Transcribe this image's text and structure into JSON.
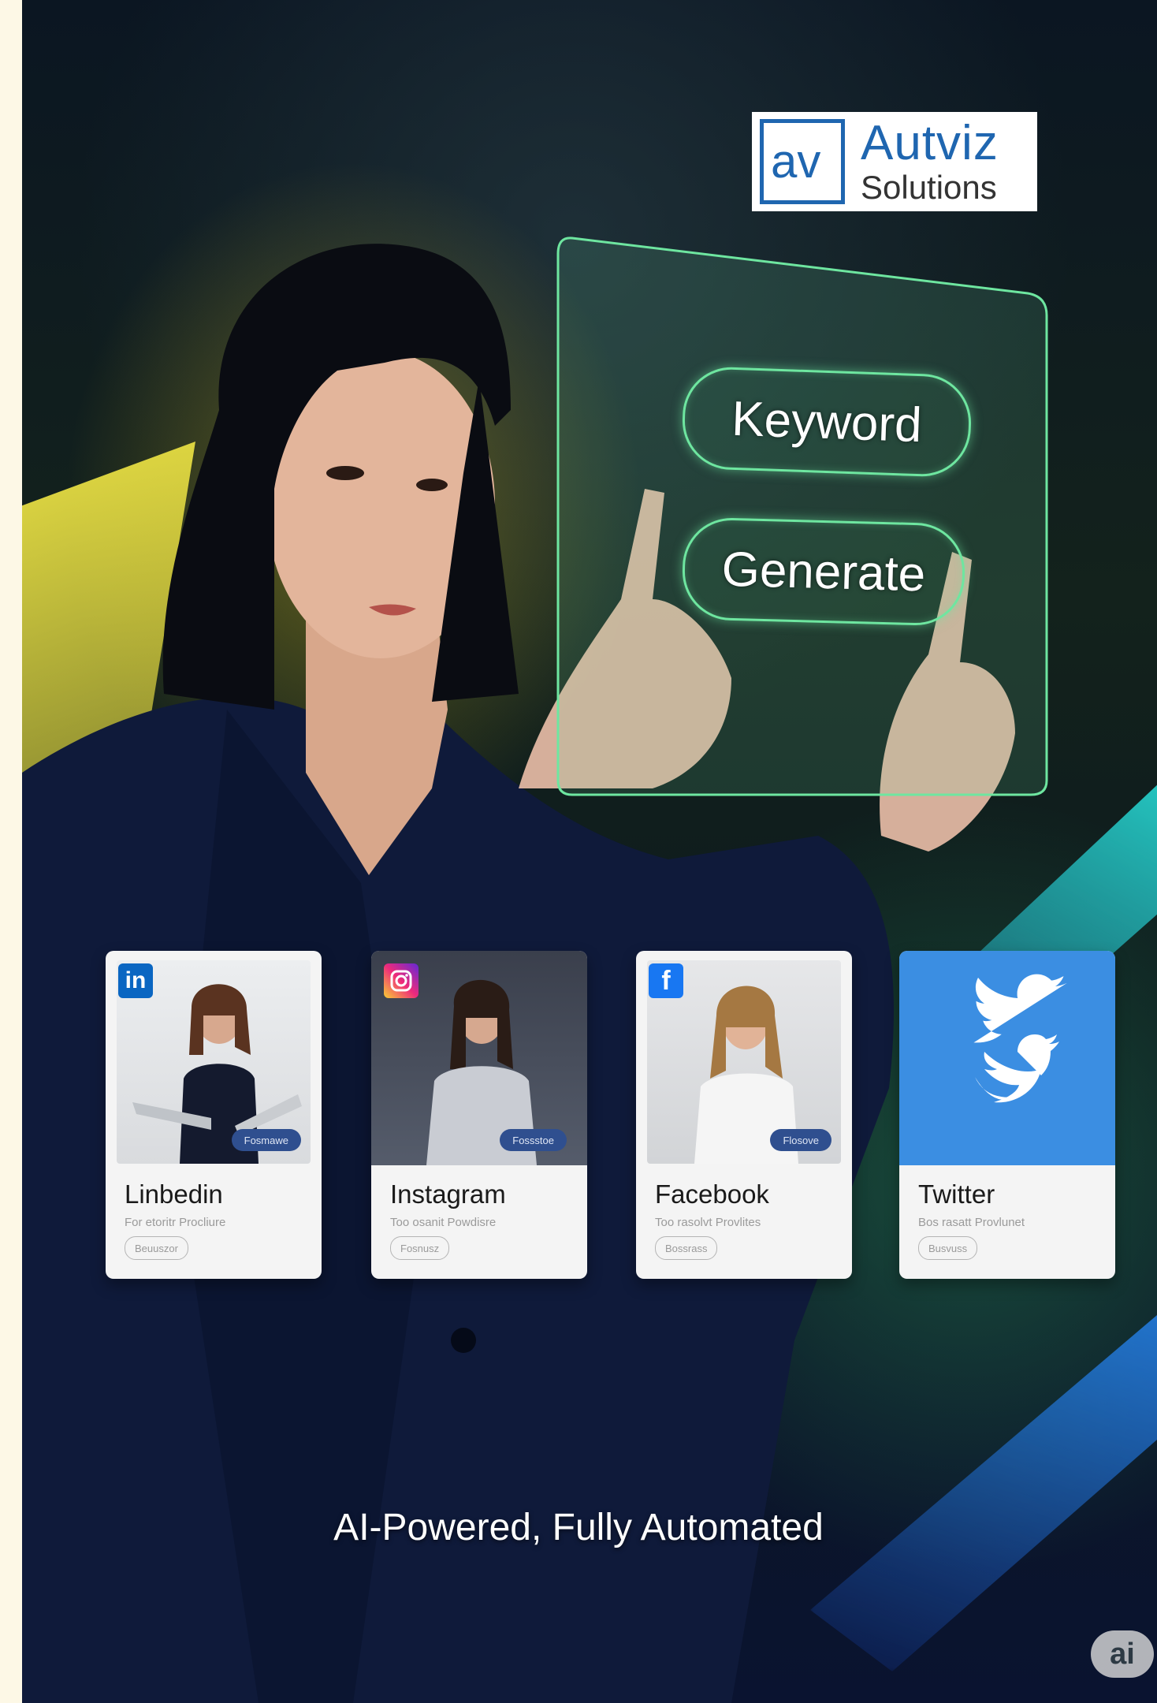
{
  "brand": {
    "logo_mark": "av",
    "name": "Autviz",
    "subtitle": "Solutions",
    "color": "#1f66b0"
  },
  "hologram": {
    "keyword_label": "Keyword",
    "generate_label": "Generate",
    "glow_color": "#6ee6a0"
  },
  "cards": [
    {
      "title": "Linbedin",
      "subtitle": "For etoritr Procliure",
      "chip": "Beuuszor",
      "tag": "Fosmawe",
      "icon": "linkedin-icon",
      "icon_glyph": "in",
      "icon_color": "#0a66c2"
    },
    {
      "title": "Instagram",
      "subtitle": "Too osanit Powdisre",
      "chip": "Fosnusz",
      "tag": "Fossstoe",
      "icon": "instagram-icon",
      "icon_glyph": "",
      "icon_color": "#d6249f"
    },
    {
      "title": "Facebook",
      "subtitle": "Too rasolvt Provlites",
      "chip": "Bossrass",
      "tag": "Flosove",
      "icon": "facebook-icon",
      "icon_glyph": "f",
      "icon_color": "#1877f2"
    },
    {
      "title": "Twitter",
      "subtitle": "Bos rasatt Provlunet",
      "chip": "Busvuss",
      "tag": "",
      "icon": "twitter-bird-icon",
      "icon_glyph": "",
      "icon_color": "#3b8ee2"
    }
  ],
  "tagline": "AI-Powered, Fully Automated",
  "ai_badge": "ai"
}
